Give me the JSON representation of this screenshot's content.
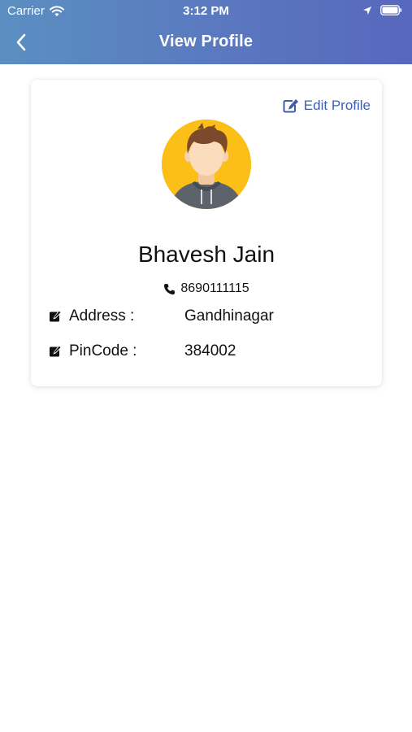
{
  "status_bar": {
    "carrier": "Carrier",
    "time": "3:12 PM"
  },
  "navbar": {
    "title": "View Profile"
  },
  "profile": {
    "edit_label": "Edit Profile",
    "name": "Bhavesh Jain",
    "phone": "8690111115",
    "fields": [
      {
        "label": "Address :",
        "value": "Gandhinagar"
      },
      {
        "label": "PinCode :",
        "value": "384002"
      }
    ]
  },
  "colors": {
    "header_start": "#5b8fc1",
    "header_end": "#5767bd",
    "accent": "#3f5fa8",
    "avatar_bg": "#fbbf17"
  }
}
